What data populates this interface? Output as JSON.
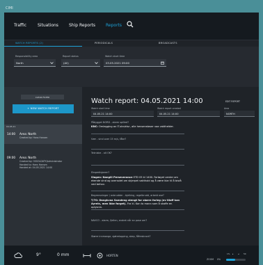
{
  "window": {
    "title": "CIMI"
  },
  "nav": {
    "items": [
      {
        "label": "Traffic",
        "active": false
      },
      {
        "label": "Situations",
        "active": false
      },
      {
        "label": "Ship Reports",
        "active": false
      },
      {
        "label": "Reports",
        "active": true
      }
    ],
    "search_icon": "search-icon"
  },
  "subtabs": [
    {
      "label": "WATCH REPORTS (2)",
      "active": true
    },
    {
      "label": "PERIODICALS",
      "active": false
    },
    {
      "label": "BROADCASTS",
      "active": false
    }
  ],
  "filters": {
    "responsibility_area": {
      "label": "Responsibility area",
      "value": "North"
    },
    "report_status": {
      "label": "Report status",
      "value": "(All)"
    },
    "watch_start": {
      "label": "Watch start time",
      "value": "03.05.2021 09:00"
    }
  },
  "left": {
    "clear_filter": "CLEAR FILTER",
    "new_report": "+ NEW WATCH REPORT",
    "date_header": "04.05.21",
    "entries": [
      {
        "time": "14:00",
        "area": "Area: North",
        "lines": [
          "Created by:  Hans Hansen"
        ]
      },
      {
        "time": "09:00",
        "area": "Area: North",
        "lines": [
          "Created by:  OSSOLDATY\\Administrator",
          "Handed to:  Hans Hansen",
          "Handed at:  04.05.2021 14:00"
        ]
      }
    ]
  },
  "report": {
    "title": "Watch report: 04.05.2021 14:00",
    "edit_label": "EDIT REPORT",
    "meta": [
      {
        "label": "Watch start time",
        "value": "04.05.21 14:00"
      },
      {
        "label": "Watch report created",
        "value": "04.05.21 14:00"
      },
      {
        "label": "Area",
        "value": "NORTH"
      }
    ],
    "questions": [
      {
        "q": "Påbygget NORD - alarm spilled?",
        "a_bold": "KNC:",
        "a": " Omlegging av IT-struktur, alle hensenstaser vaa vakthelder."
      },
      {
        "q": "Vær - vind over 15 m/s, fåke?",
        "a_bold": "",
        "a": ""
      },
      {
        "q": "Tekniske - alt OK?",
        "a_bold": "",
        "a": ""
      },
      {
        "q": "Ekspedisjonen?",
        "a_bold": "Slagen: Nangill Perseverance",
        "a": " ETD 05 kl 1400. Fartøyet venter om ekende vind og oversolet om skjerpet vakthold og å være klar til å bistå ved behov."
      },
      {
        "q": "Begrensninger / avbrudder - bjelking, regelbrudd, arbeid ose?",
        "a_bold": "T/70: Dangkvaa Samdeng stengt for større farleg (ev tilaff kan Ayrein, men ikke farget).",
        "a": " Fra kl. Kan to mann som å skaffe en oplysnin."
      },
      {
        "q": "NAVCO - alarm, fjellen, endret når ev pose om?",
        "a_bold": "",
        "a": ""
      },
      {
        "q": "Større innmange, sjøtrelopping, skep, fåfreskrock?",
        "a_bold": "",
        "a": ""
      }
    ]
  },
  "bottom": {
    "wind": "9°",
    "precip": "0 mm",
    "location": "HORTEN",
    "zoom_label": "ZOOM",
    "zoom_value": "0%",
    "zoom_fraction": 0.45,
    "scale_labels": [
      "1%",
      "▸",
      "◂",
      "50"
    ]
  }
}
